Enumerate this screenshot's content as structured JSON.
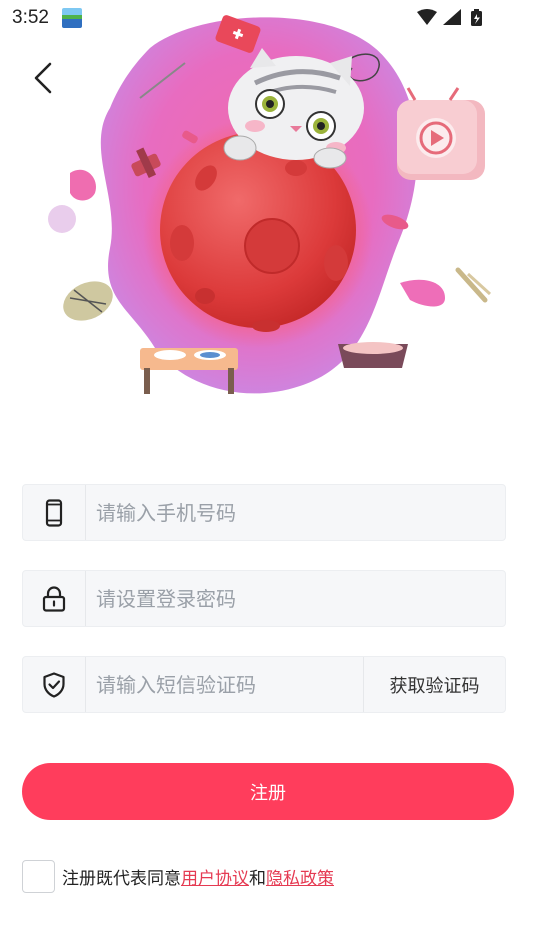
{
  "status": {
    "time": "3:52"
  },
  "form": {
    "phone_placeholder": "请输入手机号码",
    "password_placeholder": "请设置登录密码",
    "sms_placeholder": "请输入短信验证码",
    "get_code_label": "获取验证码",
    "register_label": "注册"
  },
  "agreement": {
    "prefix": "注册既代表同意",
    "user_agreement": "用户协议",
    "conjunction": "和",
    "privacy_policy": "隐私政策"
  },
  "icons": {
    "back": "chevron-left-icon",
    "phone": "phone-icon",
    "password": "lock-icon",
    "sms": "shield-check-icon"
  },
  "colors": {
    "primary": "#ff3d5c",
    "link": "#e53a52",
    "field_bg": "#f6f7f9"
  }
}
